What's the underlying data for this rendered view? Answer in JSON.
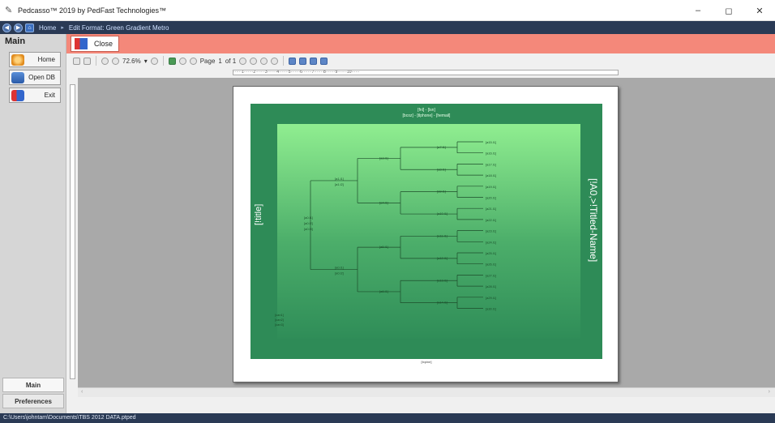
{
  "window": {
    "title": "Pedcasso™ 2019 by PedFast Technologies™",
    "controls": [
      "–",
      "◻",
      "✕"
    ]
  },
  "nav": {
    "home_label": "Home",
    "separator": "▸",
    "current": "Edit Format: Green Gradient Metro"
  },
  "sidebar": {
    "title": "Main",
    "buttons": [
      {
        "label": "Home"
      },
      {
        "label": "Open DB"
      },
      {
        "label": "Exit"
      }
    ],
    "bottom_tabs": [
      "Main",
      "Preferences"
    ]
  },
  "closebar": {
    "close_label": "Close"
  },
  "toolbar": {
    "zoom": "72.6%",
    "page_label": "Page",
    "page_number": "1",
    "page_of": "of 1"
  },
  "chart_sheet": {
    "header_line1": "[fnl] - [lsn]",
    "header_line2": "[bcoz] - [tlphone] - [hemail]",
    "left_title": "[!title]",
    "right_title": "[!A0,>!Titled-Name]",
    "footer": "[txpine]",
    "notes": [
      "[can1]",
      "[can2]",
      "[can3]"
    ],
    "g1": [
      "[a0.l1]",
      "[a0.l2]",
      "[a0.l3]"
    ],
    "g2": [
      [
        "[a1.l1]",
        "[a1.l2]"
      ],
      [
        "[a0.l1]",
        "[a0.l2]"
      ]
    ],
    "g3": [
      "[a3.l1]",
      "[a4.l1]",
      "[a5.l1]",
      "[a6.l1]"
    ],
    "g4": [
      "[a7.l1]",
      "[a8.l1]",
      "[a9.l1]",
      "[a10.l1]",
      "[a11.l1]",
      "[a12.l1]",
      "[a13.l1]",
      "[a14.l1]"
    ],
    "g5": [
      "[a15.l1]",
      "[a16.l1]",
      "[a17.l1]",
      "[a18.l1]",
      "[a19.l1]",
      "[a20.l1]",
      "[a21.l1]",
      "[a22.l1]",
      "[a23.l1]",
      "[a24.l1]",
      "[a25.l1]",
      "[a26.l1]",
      "[a27.l1]",
      "[a28.l1]",
      "[a29.l1]",
      "[a30.l1]"
    ]
  },
  "status": {
    "path": "C:\\Users\\johntam\\Documents\\TBS 2012 DATA.ptped"
  },
  "colors": {
    "nav_bg": "#2a3a55",
    "close_bar": "#f4887a",
    "sheet_outer": "#2e8b57",
    "gradient_top": "#90ee90"
  }
}
